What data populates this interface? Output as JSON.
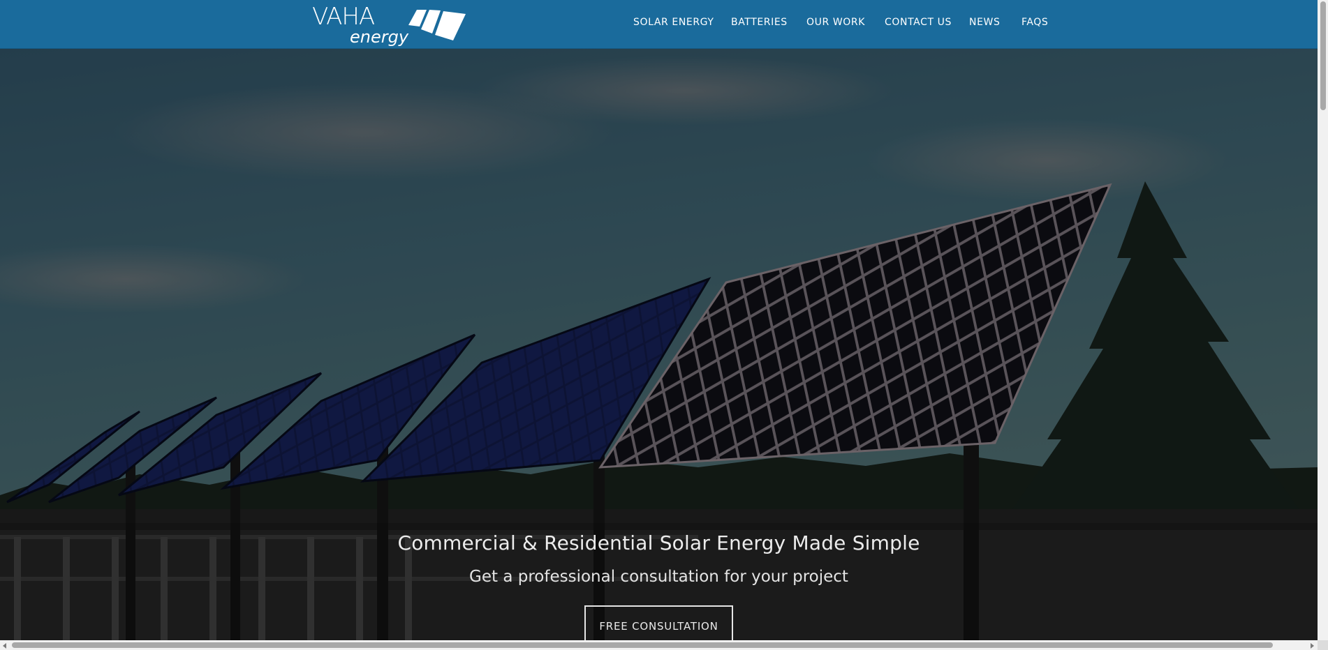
{
  "header": {
    "logo_word": "VAHA",
    "logo_sub": "energy",
    "brand_color": "#1a6b9c"
  },
  "nav": {
    "items": [
      {
        "label": "SOLAR ENERGY"
      },
      {
        "label": "BATTERIES"
      },
      {
        "label": "OUR WORK"
      },
      {
        "label": "CONTACT US"
      },
      {
        "label": "NEWS"
      },
      {
        "label": "FAQS"
      }
    ]
  },
  "hero": {
    "title": "Commercial & Residential Solar Energy Made Simple",
    "subtitle": "Get a professional consultation for your project",
    "cta_label": "FREE CONSULTATION",
    "image": "solar-panel-array-photo"
  },
  "scrollbars": {
    "vertical": "scrollbar",
    "horizontal": "scrollbar"
  }
}
